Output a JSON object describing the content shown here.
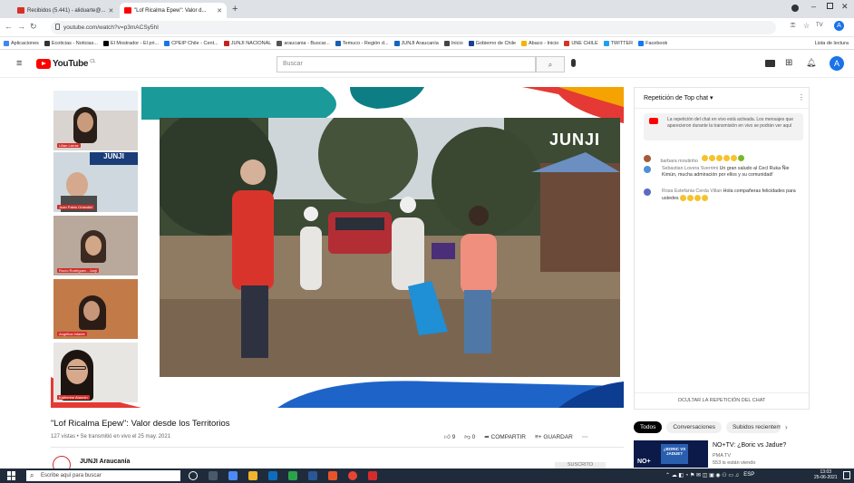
{
  "browser": {
    "tabs": [
      {
        "label": "Recibidos (5.441) - aliduarte@...",
        "active": false,
        "icon": "gmail-icon",
        "color": "#d93025"
      },
      {
        "label": "\"Lof Ricalma Epew\": Valor d...",
        "active": true,
        "icon": "youtube-icon",
        "color": "#ff0000"
      }
    ],
    "new_tab": "+",
    "url": "youtube.com/watch?v=p3mACSy5hI",
    "bookmarks": [
      {
        "label": "Aplicaciones",
        "color": "#4285f4"
      },
      {
        "label": "Ecoticias - Noticias...",
        "color": "#333333"
      },
      {
        "label": "El Mostrador - El pri...",
        "color": "#000000"
      },
      {
        "label": "CPEIP Chile - Cent...",
        "color": "#1a73e8"
      },
      {
        "label": "JUNJI NACIONAL",
        "color": "#c5221f"
      },
      {
        "label": "araucania - Buscar...",
        "color": "#555555"
      },
      {
        "label": "Temuco - Región d...",
        "color": "#1a5fb4"
      },
      {
        "label": "JUNJI Araucanía",
        "color": "#1565c0"
      },
      {
        "label": "Inicio",
        "color": "#444444"
      },
      {
        "label": "Gobierno de Chile",
        "color": "#1c3f94"
      },
      {
        "label": "Abaco - Inicio",
        "color": "#f4b400"
      },
      {
        "label": "UNE CHILE",
        "color": "#d93025"
      },
      {
        "label": "TWITTER",
        "color": "#1da1f2"
      },
      {
        "label": "Facebook",
        "color": "#1877f2"
      }
    ],
    "reading_list": "Lista de lectura"
  },
  "youtube": {
    "logo_text": "YouTube",
    "country": "CL",
    "search_placeholder": "Buscar",
    "avatar_letter": "A"
  },
  "video": {
    "title": "\"Lof Ricalma Epew\": Valor desde los Territorios",
    "meta": "127 vistas • Se transmitió en vivo el 25 may. 2021",
    "likes": "9",
    "dislikes": "0",
    "share": "COMPARTIR",
    "save": "GUARDAR",
    "brand_text": "JUNJI",
    "participants": [
      "Lilian Larraz",
      "Juan Pablo Orlandini",
      "Rocío Rodríguez - Junji",
      "Angélica Infante",
      "Katherine Alarcón"
    ]
  },
  "channel": {
    "name": "JUNJI Araucanía",
    "subscribe": "SUSCRITO"
  },
  "chat": {
    "header": "Repetición de Top chat",
    "notice": "La repetición del chat en vivo está activada. Los mensajes que aparecieron durante la transmisión en vivo se podrán ver aquí",
    "messages": [
      {
        "author": "barbara moutinho",
        "text": "",
        "avatar_color": "#a35b3a"
      },
      {
        "author": "Sebastian Lovera Sverrimi",
        "text": "Un gran saludo al Cecl Ruka Ñie Kimün, mucha admiración por ellos y su comunidad!",
        "avatar_color": "#4f8fd8"
      },
      {
        "author": "Rosa Estefania Cerda Villan",
        "text": "Hola compañeras felicidades para ustedes",
        "avatar_color": "#5c6bc0"
      }
    ],
    "hide_button": "OCULTAR LA REPETICIÓN DEL CHAT"
  },
  "filters": [
    "Todos",
    "Conversaciones",
    "Subidos recientemente"
  ],
  "recommended": {
    "title": "NO+TV: ¿Boric vs Jadue?",
    "channel": "PMA TV",
    "views": "553 is están viendo",
    "thumb_text": "¿BORIC VS JADUE?"
  },
  "taskbar": {
    "search_placeholder": "Escribe aquí para buscar",
    "time": "13:03",
    "date": "25-06-2021",
    "lang": "ESP"
  }
}
